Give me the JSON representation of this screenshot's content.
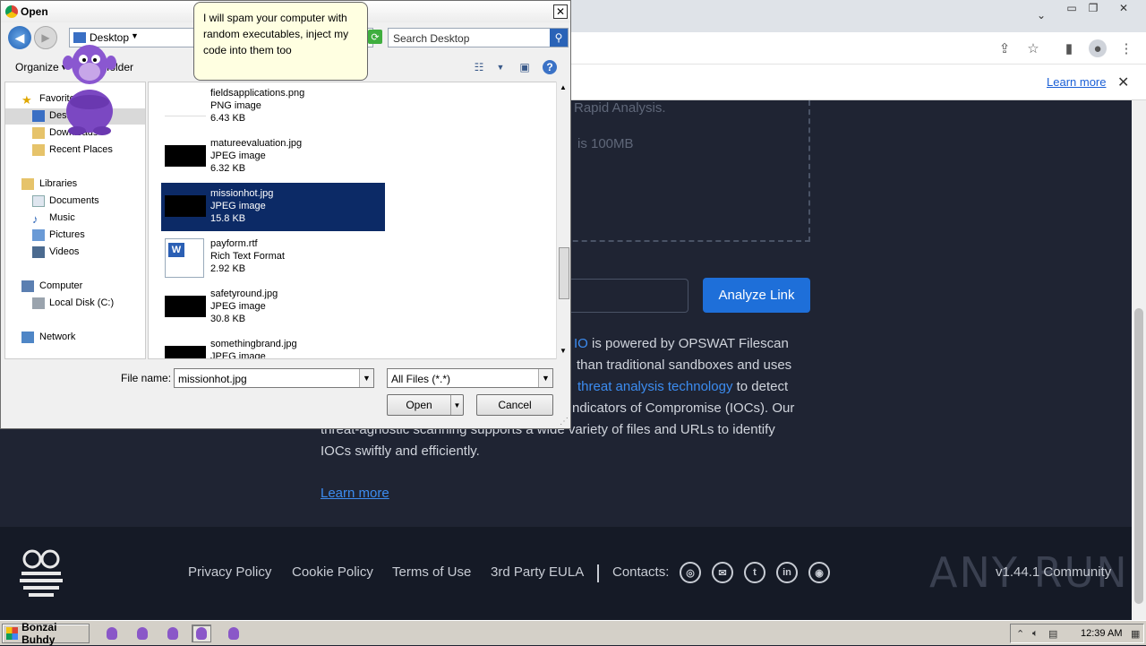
{
  "browser": {
    "notice_learn_more": "Learn more",
    "upload_line1": "Rapid Analysis.",
    "upload_line2": "is 100MB",
    "analyze_link_label": "Analyze Link",
    "paragraph": {
      "line1_link": "IO",
      "line1_text": " is powered by OPSWAT Filescan",
      "line2": "than traditional sandboxes and uses",
      "line3_link": "threat analysis technology",
      "line3_text": " to detect",
      "line4": "ndicators of Compromise (IOCs). Our",
      "line5": "threat-agnostic scanning supports a wide variety of files and URLs to identify",
      "line6": "IOCs swiftly and efficiently."
    },
    "learn_more": "Learn more",
    "footer": {
      "links": [
        "Privacy Policy",
        "Cookie Policy",
        "Terms of Use",
        "3rd Party EULA"
      ],
      "contacts_label": "Contacts:",
      "social_icons": [
        "globe-icon",
        "mail-icon",
        "twitter-icon",
        "linkedin-icon",
        "github-icon"
      ],
      "logo_text": "ANY RUN",
      "version": "v1.44.1 Community"
    }
  },
  "dialog": {
    "title": "Open",
    "breadcrumb": "Desktop",
    "search_placeholder": "Search Desktop",
    "organize": "Organize",
    "new_folder": "folder",
    "nav": {
      "favorites": "Favorites",
      "desktop": "Desktop",
      "downloads": "Downloads",
      "recent_places": "Recent Places",
      "libraries": "Libraries",
      "documents": "Documents",
      "music": "Music",
      "pictures": "Pictures",
      "videos": "Videos",
      "computer": "Computer",
      "local_disk": "Local Disk (C:)",
      "network": "Network"
    },
    "files": [
      {
        "name": "fieldsapplications.png",
        "type": "PNG image",
        "size": "6.43 KB"
      },
      {
        "name": "matureevaluation.jpg",
        "type": "JPEG image",
        "size": "6.32 KB"
      },
      {
        "name": "missionhot.jpg",
        "type": "JPEG image",
        "size": "15.8 KB"
      },
      {
        "name": "payform.rtf",
        "type": "Rich Text Format",
        "size": "2.92 KB"
      },
      {
        "name": "safetyround.jpg",
        "type": "JPEG image",
        "size": "30.8 KB"
      },
      {
        "name": "somethingbrand.jpg",
        "type": "JPEG image",
        "size": ""
      }
    ],
    "file_name_label": "File name:",
    "file_name_value": "missionhot.jpg",
    "filter_value": "All Files (*.*)",
    "open_label": "Open",
    "cancel_label": "Cancel"
  },
  "bonzi": {
    "speech": "I will spam your computer with random executables, inject my code into them too"
  },
  "taskbar": {
    "start_label": "Bonzai Buhdy",
    "clock": "12:39 AM"
  }
}
